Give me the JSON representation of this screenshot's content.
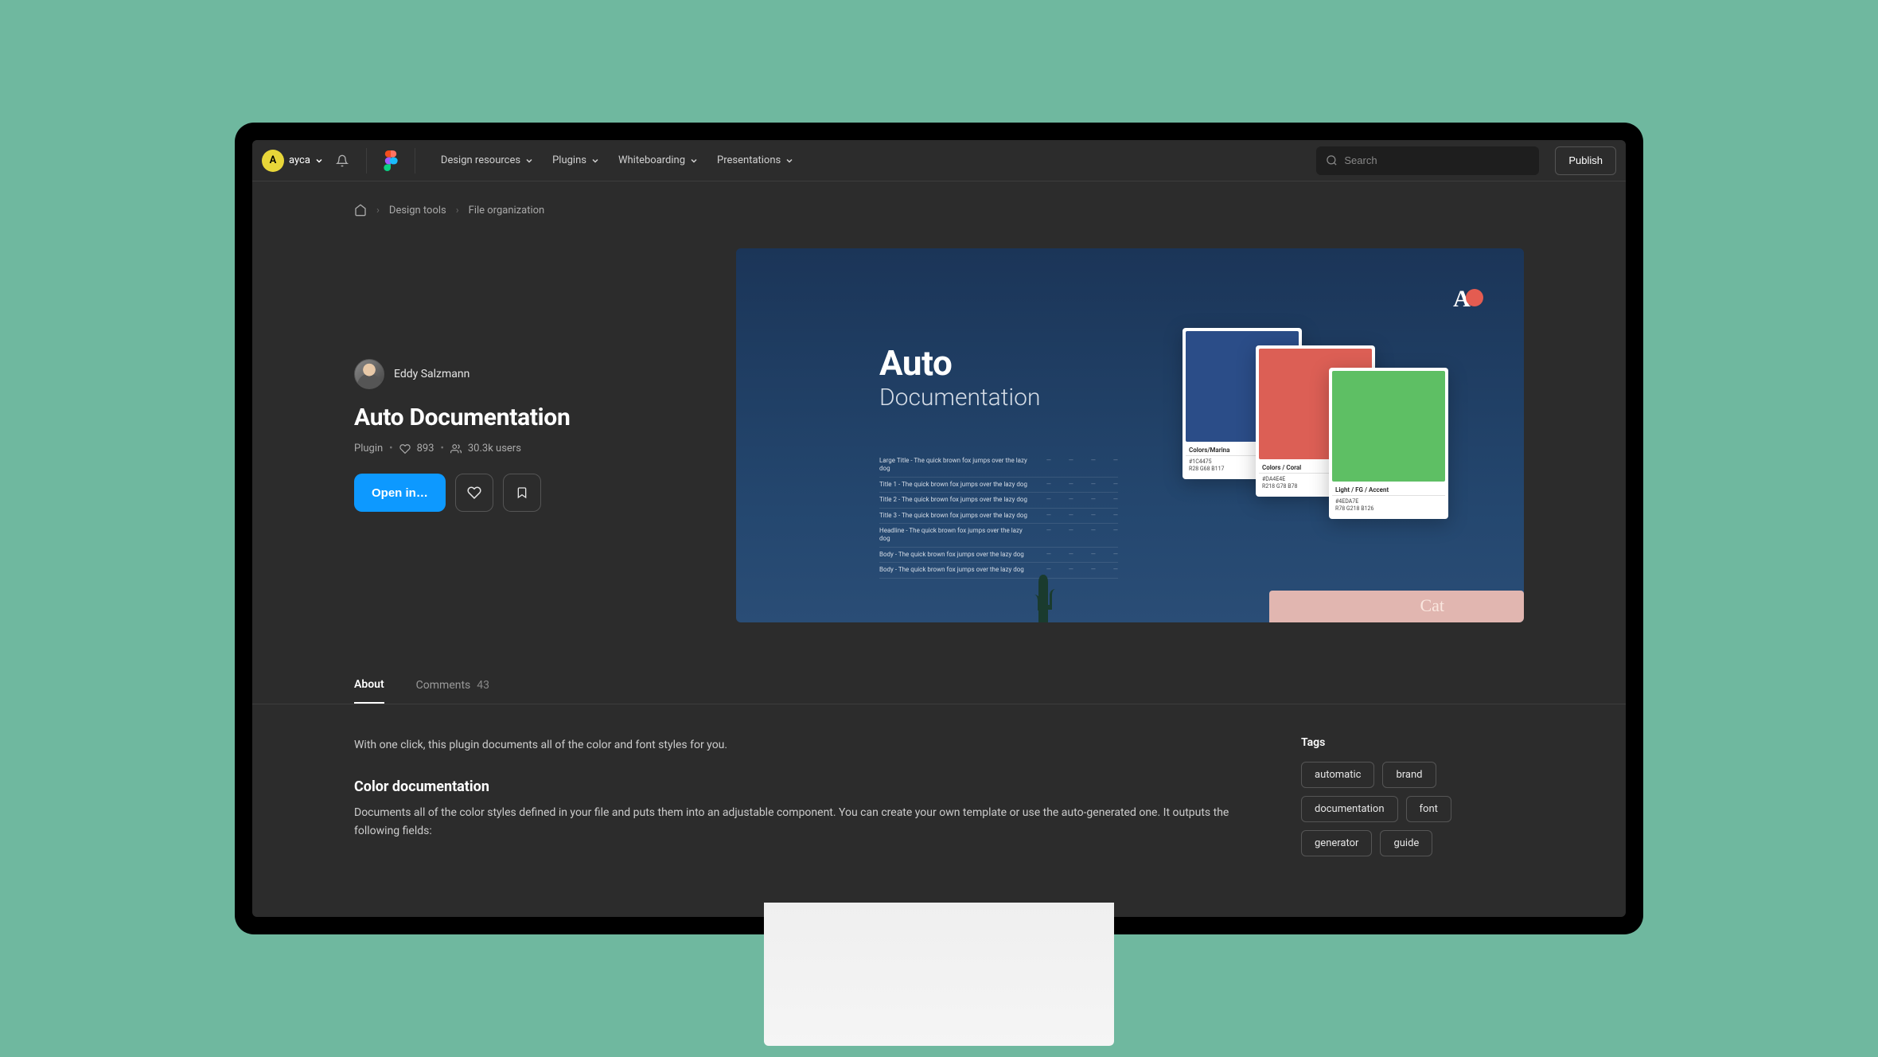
{
  "user": {
    "initial": "A",
    "name": "ayca"
  },
  "nav": {
    "design_resources": "Design resources",
    "plugins": "Plugins",
    "whiteboarding": "Whiteboarding",
    "presentations": "Presentations"
  },
  "search": {
    "placeholder": "Search"
  },
  "publish_label": "Publish",
  "breadcrumb": {
    "design_tools": "Design tools",
    "file_organization": "File organization"
  },
  "plugin": {
    "author": "Eddy Salzmann",
    "title": "Auto Documentation",
    "type": "Plugin",
    "likes": "893",
    "users": "30.3k users",
    "open_label": "Open in…"
  },
  "hero": {
    "h1": "Auto",
    "h2": "Documentation",
    "signature": "Cat",
    "typerows": [
      {
        "label": "Large Title - The quick brown fox jumps over the lazy dog"
      },
      {
        "label": "Title 1 - The quick brown fox jumps over the lazy dog"
      },
      {
        "label": "Title 2 - The quick brown fox jumps over the lazy dog"
      },
      {
        "label": "Title 3 - The quick brown fox jumps over the lazy dog"
      },
      {
        "label": "Headline - The quick brown fox jumps over the lazy dog"
      },
      {
        "label": "Body - The quick brown fox jumps over the lazy dog"
      },
      {
        "label": "Body - The quick brown fox jumps over the lazy dog"
      }
    ],
    "cards": [
      {
        "name": "Colors/Marina",
        "hex": "#1C4475",
        "rgb": "R28  G68  B117"
      },
      {
        "name": "Colors / Coral",
        "hex": "#DA4E4E",
        "rgb": "R218  G78  B78"
      },
      {
        "name": "Light / FG / Accent",
        "hex": "#4EDA7E",
        "rgb": "R78  G218  B126"
      }
    ]
  },
  "tabs": {
    "about": "About",
    "comments_label": "Comments",
    "comments_count": "43"
  },
  "description": {
    "intro": "With one click, this plugin documents all of the color and font styles for you.",
    "h_color": "Color documentation",
    "p_color": "Documents all of the color styles defined in your file and puts them into an adjustable component. You can create your own template or use the auto-generated one. It outputs the following fields:"
  },
  "tags": {
    "title": "Tags",
    "items": [
      "automatic",
      "brand",
      "documentation",
      "font",
      "generator",
      "guide"
    ]
  }
}
